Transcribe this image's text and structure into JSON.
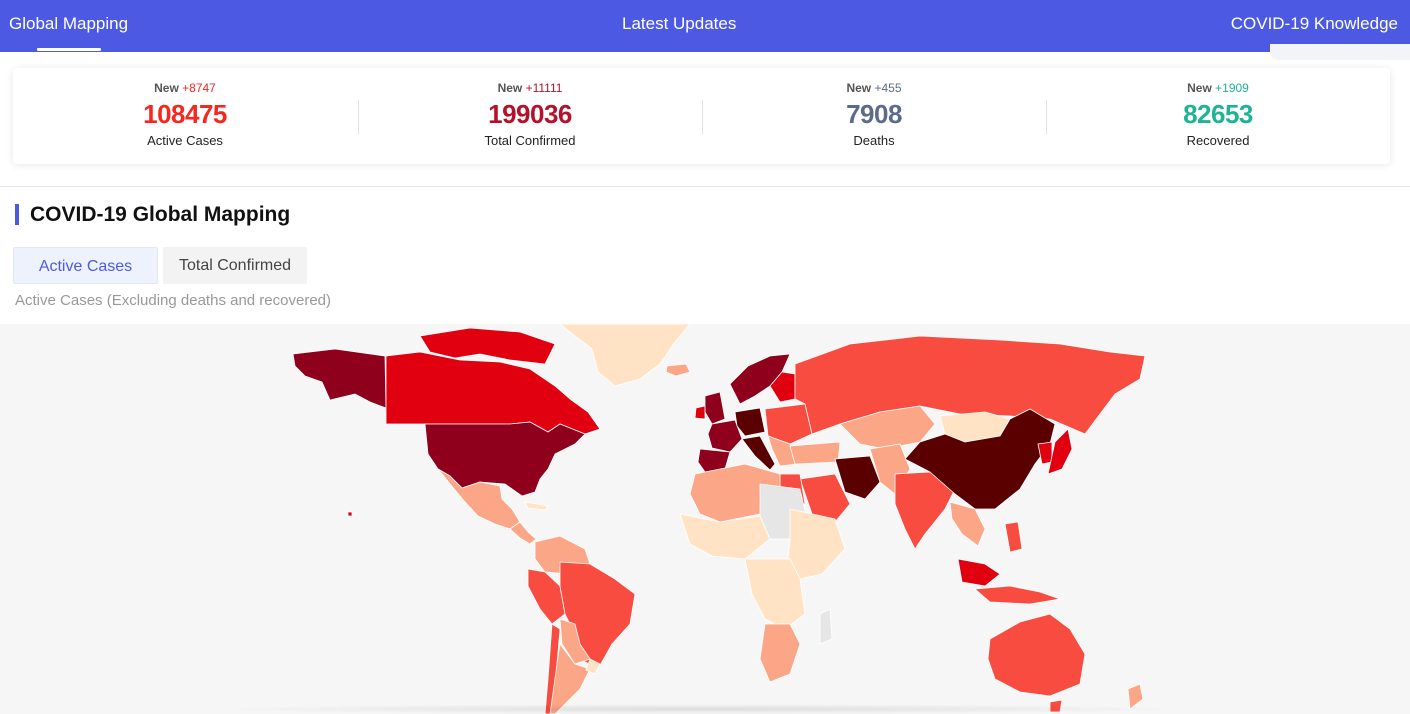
{
  "nav": {
    "left": "Global Mapping",
    "middle": "Latest Updates",
    "right": "COVID-19 Knowledge"
  },
  "stats": [
    {
      "new_label": "New",
      "delta": "+8747",
      "value": "108475",
      "label": "Active Cases",
      "color": "#f5271e"
    },
    {
      "new_label": "New",
      "delta": "+11111",
      "value": "199036",
      "label": "Total Confirmed",
      "color": "#b5112a"
    },
    {
      "new_label": "New",
      "delta": "+455",
      "value": "7908",
      "label": "Deaths",
      "color": "#5b6b8c"
    },
    {
      "new_label": "New",
      "delta": "+1909",
      "value": "82653",
      "label": "Recovered",
      "color": "#1fb396"
    }
  ],
  "section": {
    "title": "COVID-19 Global Mapping",
    "tabs": [
      "Active Cases",
      "Total Confirmed"
    ],
    "note": "Active Cases (Excluding deaths and recovered)"
  },
  "map": {
    "scale_colors": {
      "none": "#e6e6e6",
      "very_low": "#ffe3c4",
      "low": "#fca688",
      "medium": "#f94c40",
      "high": "#e1000f",
      "very_high": "#8f001c",
      "extreme": "#5a0000"
    }
  }
}
